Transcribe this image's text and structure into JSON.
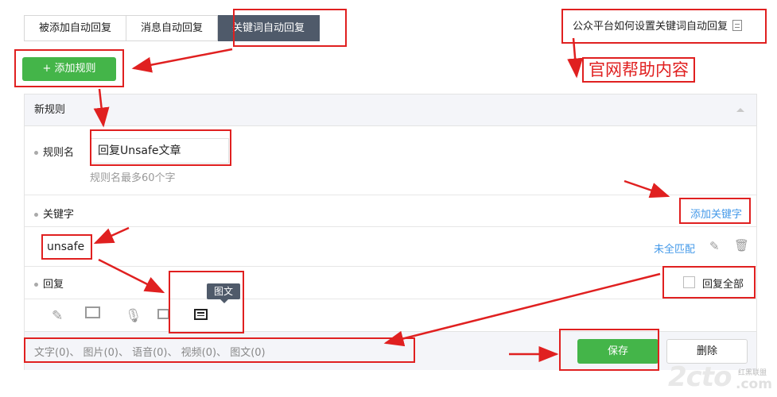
{
  "tabs": [
    "被添加自动回复",
    "消息自动回复",
    "关键词自动回复"
  ],
  "help_link": "公众平台如何设置关键词自动回复",
  "annotation": "官网帮助内容",
  "add_rule_button": "+ 添加规则",
  "panel": {
    "title": "新规则",
    "rule_name_label": "规则名",
    "rule_name_value": "回复Unsafe文章",
    "rule_name_hint": "规则名最多60个字",
    "keyword_label": "关键字",
    "add_keyword_link": "添加关键字",
    "keyword_value": "unsafe",
    "match_mode": "未全匹配",
    "reply_label": "回复",
    "reply_all_label": "回复全部",
    "tooltip": "图文",
    "reply_types": [
      "text-icon",
      "image-icon",
      "voice-icon",
      "video-icon",
      "news-icon"
    ],
    "counts": "文字(0)、 图片(0)、 语音(0)、 视频(0)、 图文(0)",
    "save_button": "保存",
    "delete_button": "删除"
  },
  "watermark": {
    "main": "2cto",
    "sub": "红黑联盟",
    "com": ".com"
  },
  "colors": {
    "accent_green": "#44b549",
    "annotation_red": "#e02020",
    "link_blue": "#459ae9",
    "active_tab": "#4f5a6a"
  }
}
